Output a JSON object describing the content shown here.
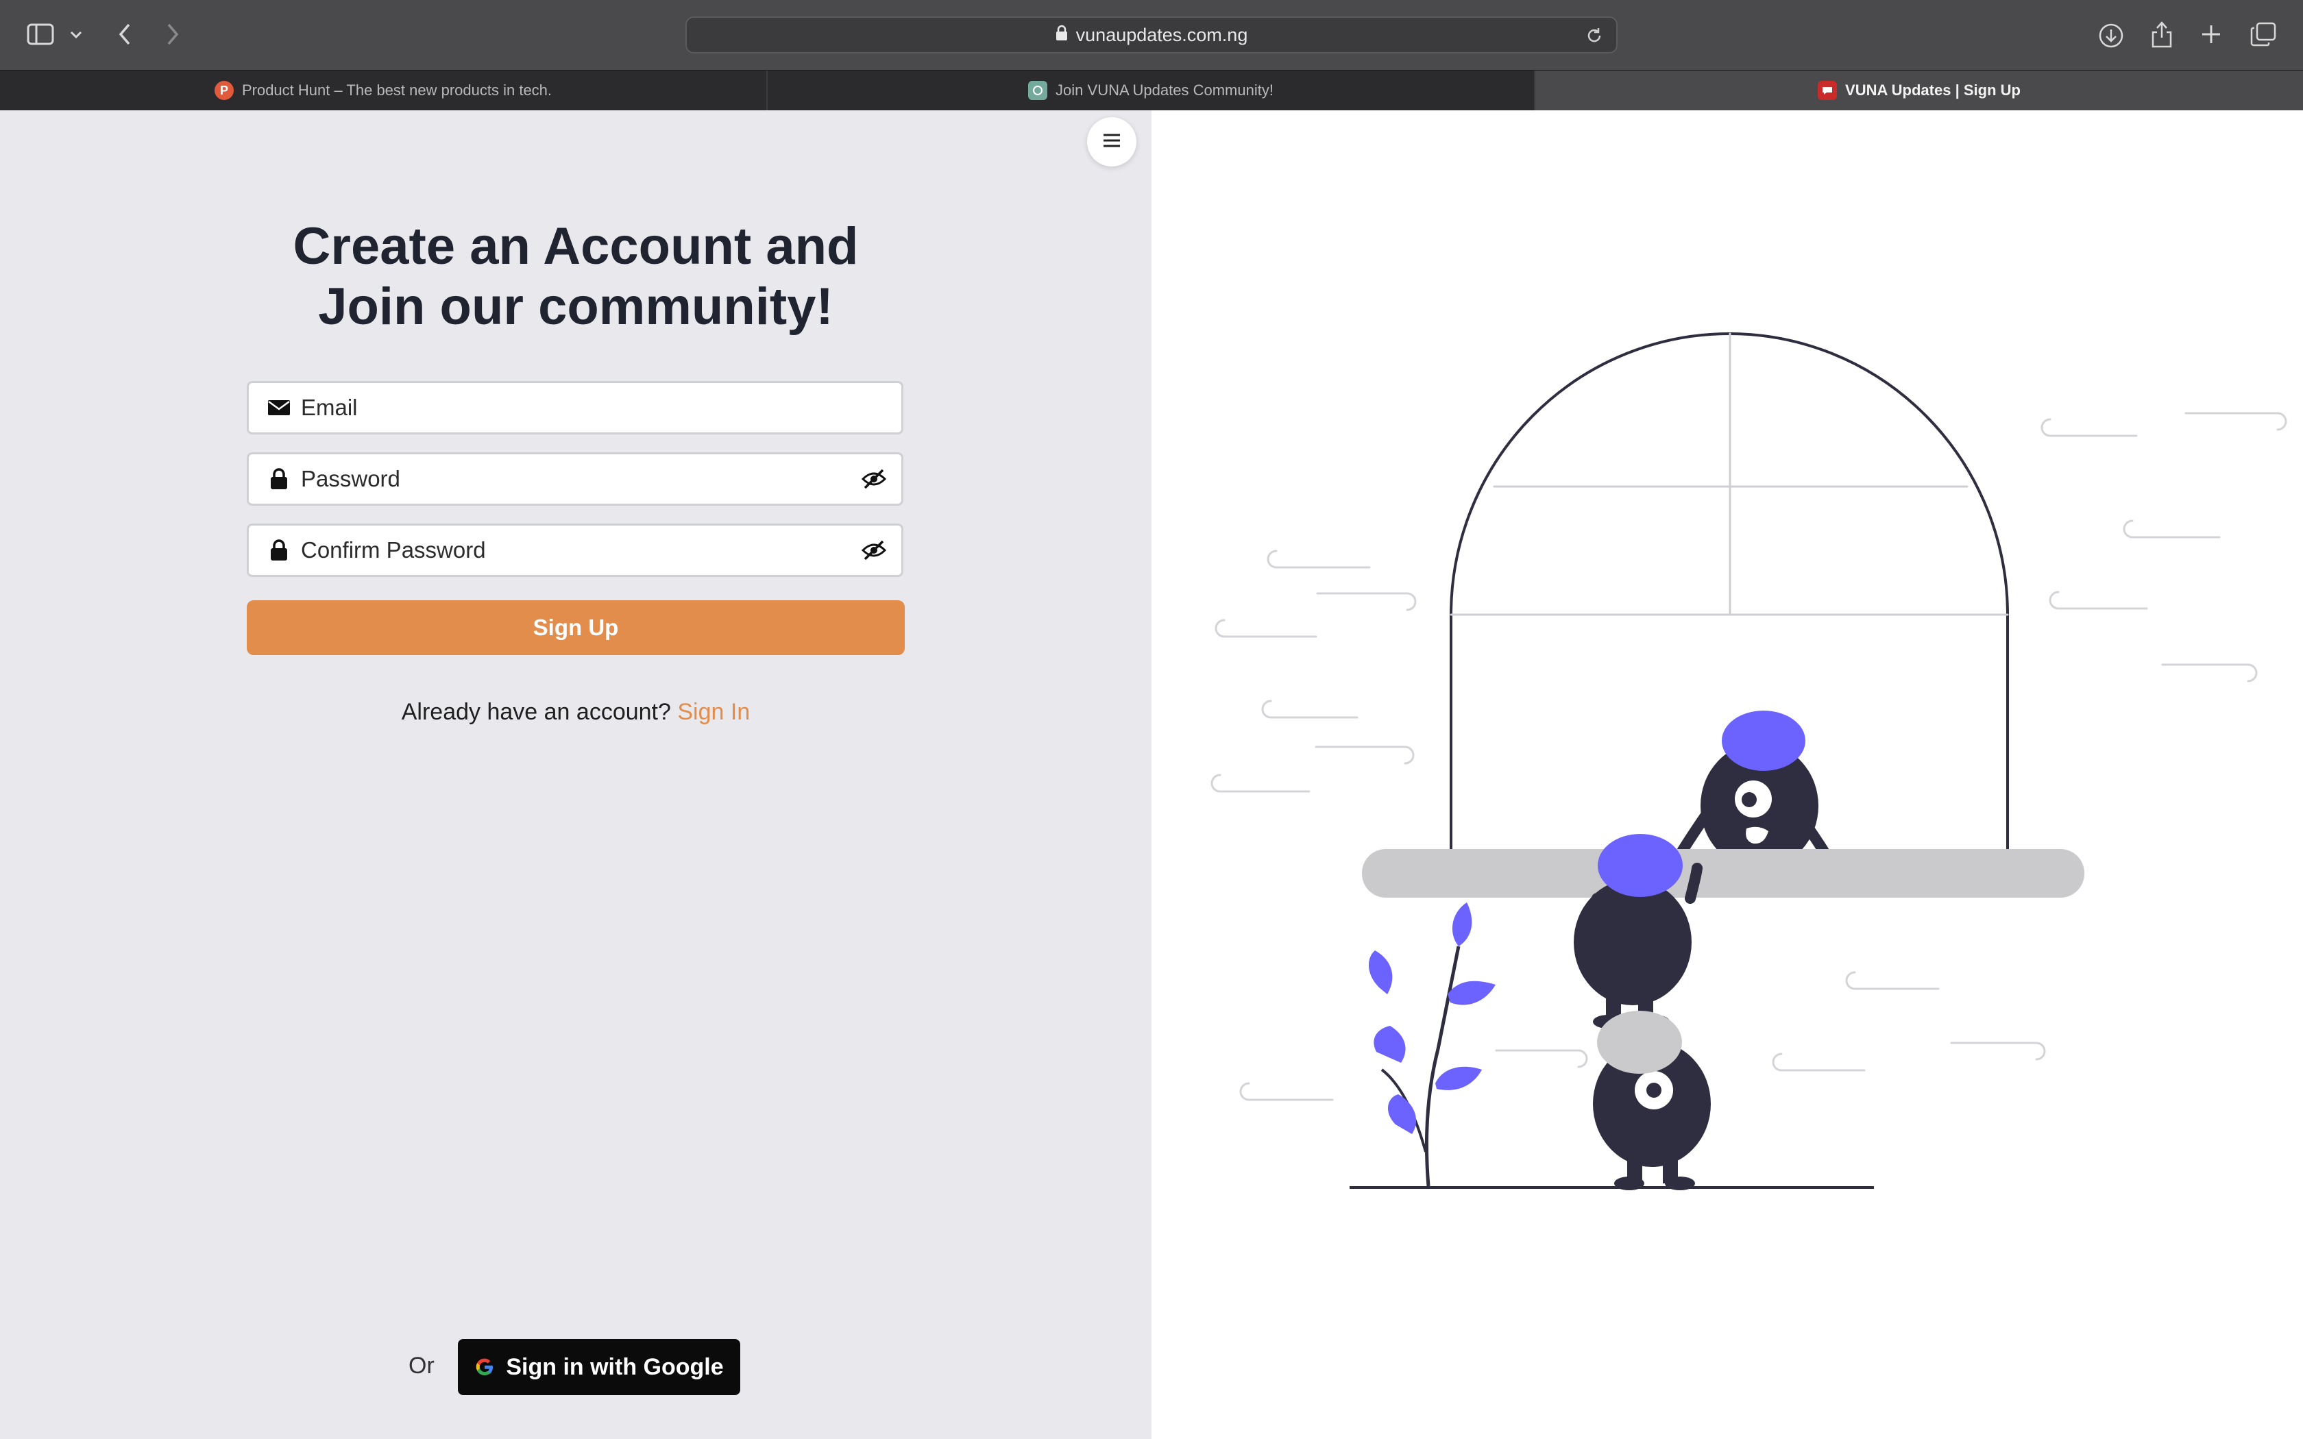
{
  "browser": {
    "url": "vunaupdates.com.ng",
    "tabs": [
      {
        "title": "Product Hunt – The best new products in tech.",
        "favicon": "product-hunt-icon",
        "favicon_letter": "P",
        "active": false
      },
      {
        "title": "Join VUNA Updates Community!",
        "favicon": "chatgpt-icon",
        "active": false
      },
      {
        "title": "VUNA Updates | Sign Up",
        "favicon": "vuna-icon",
        "active": true
      }
    ]
  },
  "form": {
    "heading_line1": "Create an Account and",
    "heading_line2": "Join our community!",
    "email_placeholder": "Email",
    "password_placeholder": "Password",
    "confirm_placeholder": "Confirm Password",
    "signup_label": "Sign Up",
    "already_text": "Already have an account?",
    "signin_link": "Sign In",
    "or_text": "Or",
    "google_label": "Sign in with Google"
  },
  "colors": {
    "accent": "#e28d4c",
    "left_bg": "#e9e9ed",
    "illustration_purple": "#6c63ff",
    "illustration_dark": "#2f2e41"
  }
}
